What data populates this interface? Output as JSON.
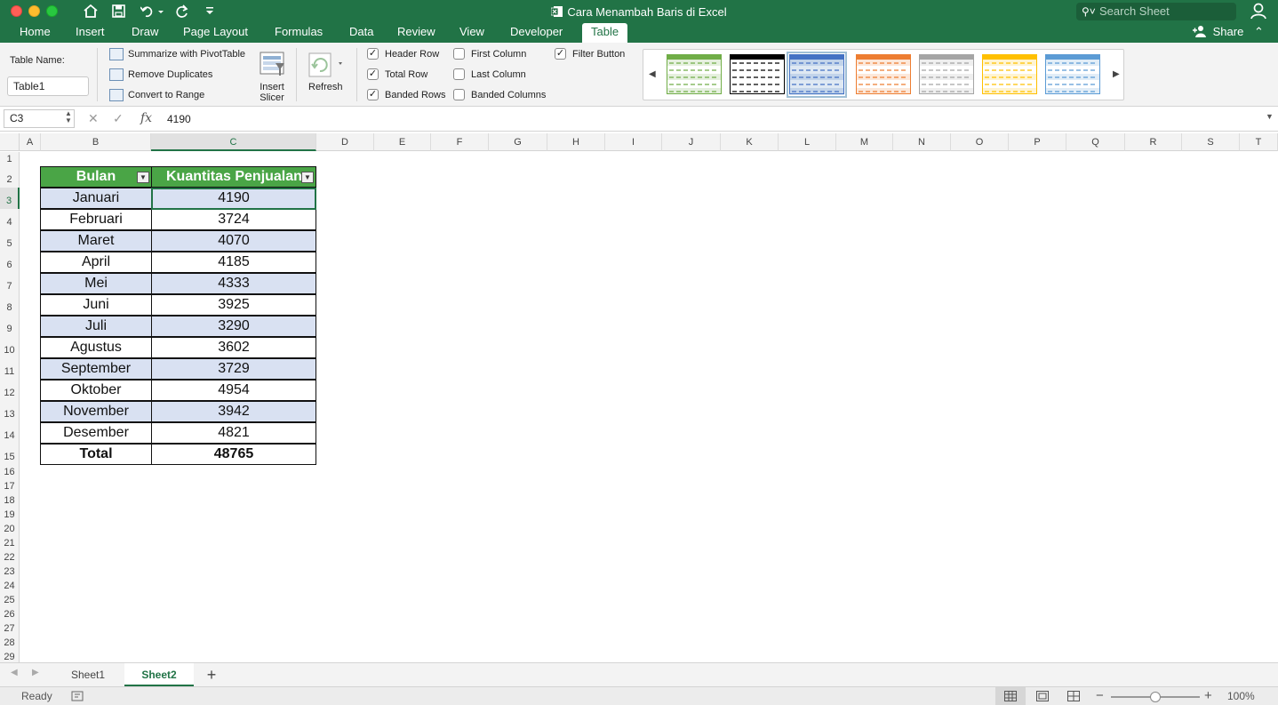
{
  "window": {
    "title": "Cara Menambah Baris di Excel"
  },
  "search": {
    "placeholder": "Search Sheet"
  },
  "ribbon_tabs": [
    "Home",
    "Insert",
    "Draw",
    "Page Layout",
    "Formulas",
    "Data",
    "Review",
    "View",
    "Developer",
    "Table"
  ],
  "share_label": "Share",
  "table_tools": {
    "name_label": "Table Name:",
    "name_value": "Table1",
    "summarize": "Summarize with PivotTable",
    "remove_dup": "Remove Duplicates",
    "convert": "Convert to Range",
    "insert_slicer_1": "Insert",
    "insert_slicer_2": "Slicer",
    "refresh": "Refresh",
    "options": {
      "header_row": {
        "label": "Header Row",
        "checked": true
      },
      "total_row": {
        "label": "Total Row",
        "checked": true
      },
      "banded_rows": {
        "label": "Banded Rows",
        "checked": true
      },
      "first_column": {
        "label": "First Column",
        "checked": false
      },
      "last_column": {
        "label": "Last Column",
        "checked": false
      },
      "banded_columns": {
        "label": "Banded Columns",
        "checked": false
      },
      "filter_button": {
        "label": "Filter Button",
        "checked": true
      }
    },
    "style_colors": [
      "#70ad47",
      "#000000",
      "#4472c4",
      "#ed7d31",
      "#a5a5a5",
      "#ffc000",
      "#5b9bd5"
    ]
  },
  "formula_bar": {
    "name_box": "C3",
    "fx": "fx",
    "value": "4190"
  },
  "columns": [
    "A",
    "B",
    "C",
    "D",
    "E",
    "F",
    "G",
    "H",
    "I",
    "J",
    "K",
    "L",
    "M",
    "N",
    "O",
    "P",
    "Q",
    "R",
    "S",
    "T"
  ],
  "rows": [
    "1",
    "2",
    "3",
    "4",
    "5",
    "6",
    "7",
    "8",
    "9",
    "10",
    "11",
    "12",
    "13",
    "14",
    "15",
    "16",
    "17",
    "18",
    "19",
    "20",
    "21",
    "22",
    "23",
    "24",
    "25",
    "26",
    "27",
    "28",
    "29"
  ],
  "table": {
    "headers": [
      "Bulan",
      "Kuantitas Penjualan"
    ],
    "rows": [
      [
        "Januari",
        "4190"
      ],
      [
        "Februari",
        "3724"
      ],
      [
        "Maret",
        "4070"
      ],
      [
        "April",
        "4185"
      ],
      [
        "Mei",
        "4333"
      ],
      [
        "Juni",
        "3925"
      ],
      [
        "Juli",
        "3290"
      ],
      [
        "Agustus",
        "3602"
      ],
      [
        "September",
        "3729"
      ],
      [
        "Oktober",
        "4954"
      ],
      [
        "November",
        "3942"
      ],
      [
        "Desember",
        "4821"
      ]
    ],
    "total": [
      "Total",
      "48765"
    ]
  },
  "sheets": [
    "Sheet1",
    "Sheet2"
  ],
  "add_sheet": "+",
  "status": {
    "ready": "Ready",
    "zoom": "100%"
  },
  "colors": {
    "accent": "#217346",
    "header_fill": "#4aa546",
    "band_fill": "#d9e1f2"
  }
}
